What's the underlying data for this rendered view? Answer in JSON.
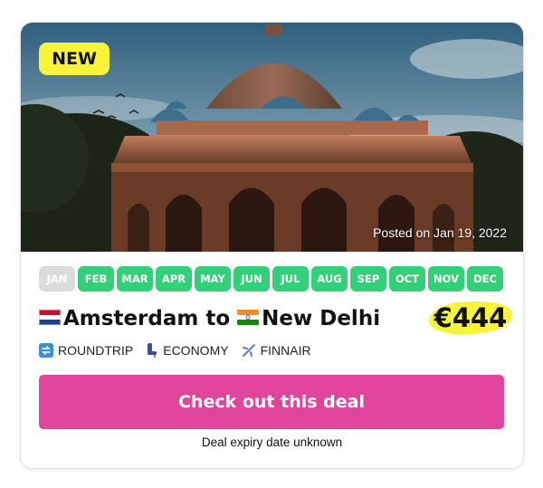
{
  "card": {
    "badge": "NEW",
    "posted": "Posted on Jan 19, 2022",
    "months": [
      {
        "label": "JAN",
        "active": false
      },
      {
        "label": "FEB",
        "active": true
      },
      {
        "label": "MAR",
        "active": true
      },
      {
        "label": "APR",
        "active": true
      },
      {
        "label": "MAY",
        "active": true
      },
      {
        "label": "JUN",
        "active": true
      },
      {
        "label": "JUL",
        "active": true
      },
      {
        "label": "AUG",
        "active": true
      },
      {
        "label": "SEP",
        "active": true
      },
      {
        "label": "OCT",
        "active": true
      },
      {
        "label": "NOV",
        "active": true
      },
      {
        "label": "DEC",
        "active": true
      }
    ],
    "route": {
      "origin": "Amsterdam",
      "connector": "to",
      "destination": "New Delhi",
      "origin_flag": "netherlands-flag-icon",
      "destination_flag": "india-flag-icon"
    },
    "price": "€444",
    "tags": [
      {
        "icon": "roundtrip-icon",
        "label": "ROUNDTRIP"
      },
      {
        "icon": "seat-icon",
        "label": "ECONOMY"
      },
      {
        "icon": "airplane-icon",
        "label": "FINNAIR"
      }
    ],
    "cta_label": "Check out this deal",
    "expiry": "Deal expiry date unknown"
  },
  "colors": {
    "badge_yellow": "#f8f43a",
    "month_active": "#33d079",
    "month_inactive": "#dcdcdc",
    "cta_pink": "#e1449b"
  }
}
